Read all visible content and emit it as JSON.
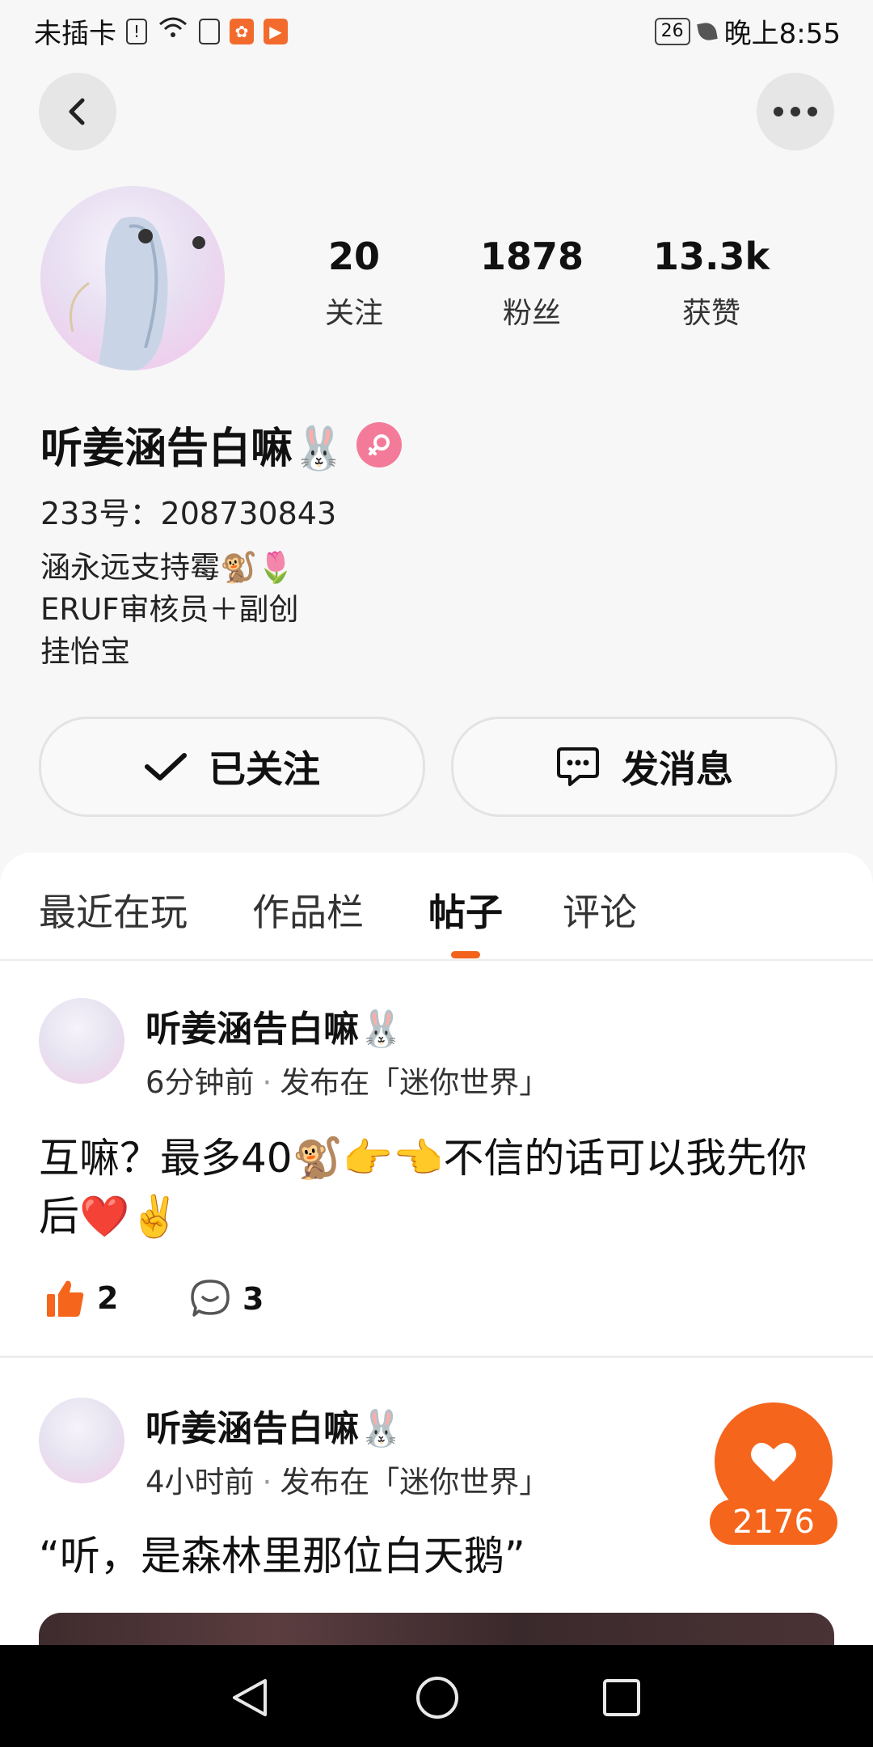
{
  "status_bar": {
    "carrier": "未插卡",
    "battery": "26",
    "time": "晚上8:55"
  },
  "profile": {
    "following_count": "20",
    "following_label": "关注",
    "followers_count": "1878",
    "followers_label": "粉丝",
    "likes_count": "13.3k",
    "likes_label": "获赞",
    "name": "听姜涵告白嘛🐰",
    "id_line": "233号：208730843",
    "bio": [
      "涵永远支持霉🐒🌷",
      "ERUF审核员＋副创",
      "挂怡宝"
    ]
  },
  "actions": {
    "follow_label": "已关注",
    "message_label": "发消息"
  },
  "tabs": [
    "最近在玩",
    "作品栏",
    "帖子",
    "评论"
  ],
  "active_tab": "帖子",
  "posts": [
    {
      "author": "听姜涵告白嘛🐰",
      "time": "6分钟前",
      "location": "发布在「迷你世界」",
      "body": "互嘛？最多40🐒👉👈不信的话可以我先你后❤️✌️",
      "likes": "2",
      "comments": "3"
    },
    {
      "author": "听姜涵告白嘛🐰",
      "time": "4小时前",
      "location": "发布在「迷你世界」",
      "body": "“听，是森林里那位白天鹅”"
    }
  ],
  "like_fab_count": "2176",
  "colors": {
    "accent": "#f5651c",
    "gender": "#f37b99"
  }
}
